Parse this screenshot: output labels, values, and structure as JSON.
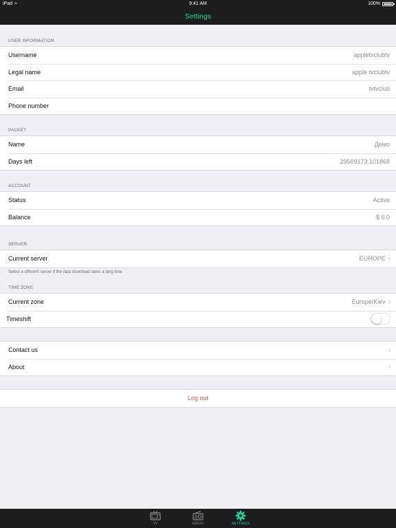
{
  "status_bar": {
    "device": "iPad",
    "time": "9:41 AM",
    "battery": "100%"
  },
  "nav": {
    "title": "Settings"
  },
  "sections": {
    "user_info": {
      "header": "USER INFORMATION",
      "rows": [
        {
          "label": "Username",
          "value": "appletvclubtv"
        },
        {
          "label": "Legal name",
          "value": "apple tvclubtv"
        },
        {
          "label": "Email",
          "value": "tvtvclub"
        },
        {
          "label": "Phone number",
          "value": ""
        }
      ]
    },
    "packet": {
      "header": "PACKET",
      "rows": [
        {
          "label": "Name",
          "value": "Демо"
        },
        {
          "label": "Days left",
          "value": "29509173.101868"
        }
      ]
    },
    "account": {
      "header": "ACCOUNT",
      "rows": [
        {
          "label": "Status",
          "value": "Active"
        },
        {
          "label": "Balance",
          "value": "$ 0.0"
        }
      ]
    },
    "server": {
      "header": "SERVER",
      "rows": [
        {
          "label": "Current server",
          "value": "EUROPE"
        }
      ],
      "footer": "Select a different server if the data download takes a long time"
    },
    "time_zone": {
      "header": "TIME ZONE",
      "rows": [
        {
          "label": "Current zone",
          "value": "Europe/Kiev"
        },
        {
          "label": "Timeshift",
          "toggle_on": false
        }
      ]
    },
    "misc": {
      "rows": [
        {
          "label": "Contact us"
        },
        {
          "label": "About"
        }
      ]
    },
    "logout": {
      "label": "Log out"
    }
  },
  "tabs": [
    {
      "label": "TV",
      "icon": "tv-icon",
      "active": false
    },
    {
      "label": "RADIO",
      "icon": "radio-icon",
      "active": false
    },
    {
      "label": "SETTINGS",
      "icon": "gear-icon",
      "active": true
    }
  ],
  "colors": {
    "accent": "#1dd3a0",
    "destructive": "#d3584b",
    "bar": "#1d1d1d",
    "background": "#efeff4"
  }
}
